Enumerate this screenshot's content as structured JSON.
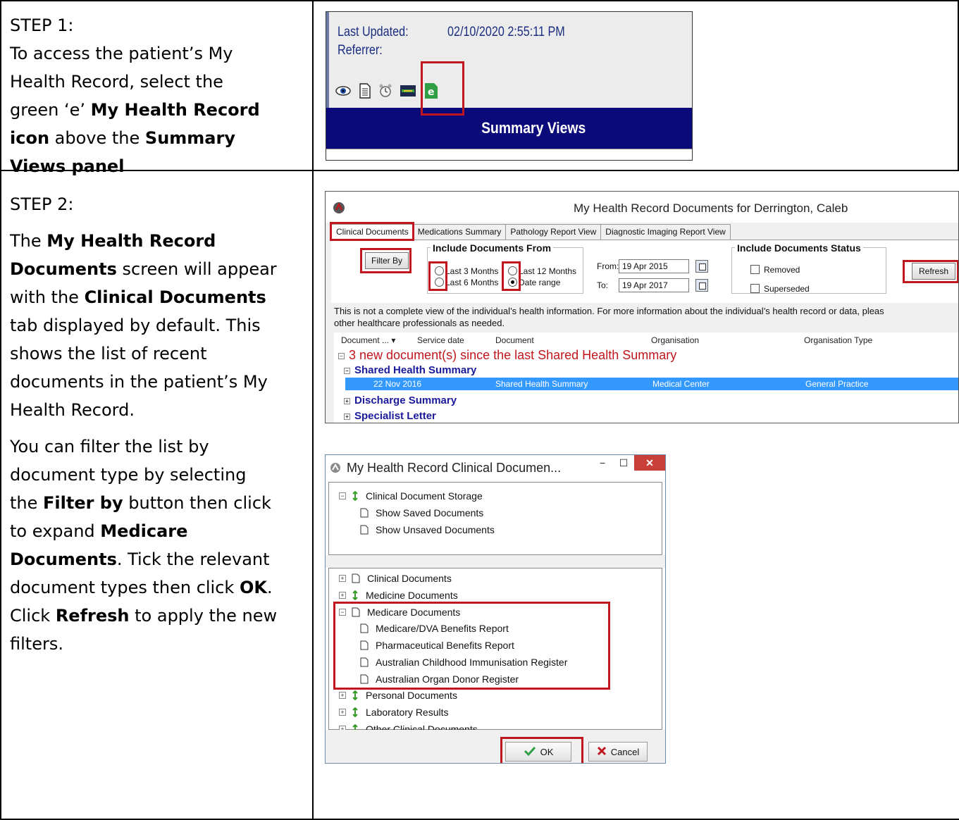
{
  "step1": {
    "heading": "STEP 1:",
    "line1": "To access the patient’s My",
    "line2": "Health Record, select the",
    "line3_a": "green ‘e’ ",
    "line3_b": "My Health Record",
    "line4_a": "icon",
    "line4_b": " above the ",
    "line4_c": "Summary",
    "line5": "Views panel",
    "screenshot": {
      "last_updated_label": "Last Updated:",
      "last_updated_value": "02/10/2020 2:55:11 PM",
      "referrer_label": "Referrer:",
      "summary_views": "Summary Views",
      "icons": [
        "eye-icon",
        "document-icon",
        "alarm-clock-icon",
        "image-icon",
        "my-health-record-e-icon"
      ],
      "e_icon_color": "#2f9e44"
    }
  },
  "step2": {
    "heading": "STEP 2:",
    "p1_1a": "The ",
    "p1_1b": "My Health Record",
    "p1_2a": "Documents",
    "p1_2b": " screen will appear",
    "p1_3a": "with the ",
    "p1_3b": "Clinical Documents",
    "p1_4": "tab displayed by default. This",
    "p1_5": "shows the list of recent",
    "p1_6": "documents in the patient’s My",
    "p1_7": "Health Record.",
    "p2_1": "You can filter the list by",
    "p2_2": "document type by selecting",
    "p2_3a": "the ",
    "p2_3b": "Filter by",
    "p2_3c": " button then click",
    "p2_4a": "to expand ",
    "p2_4b": "Medicare",
    "p2_5a": "Documents",
    "p2_5b": ". Tick the relevant",
    "p2_6a": "document types then click ",
    "p2_6b": "OK",
    "p2_6c": ".",
    "p2_7a": "Click ",
    "p2_7b": "Refresh",
    "p2_7c": " to apply the new",
    "p2_8": "filters."
  },
  "documents_window": {
    "title": "My Health Record Documents for Derrington, Caleb",
    "tabs": [
      "Clinical Documents",
      "Medications Summary",
      "Pathology Report View",
      "Diagnostic Imaging Report View"
    ],
    "filter_by": "Filter By",
    "include_from": "Include Documents From",
    "last3": "Last 3 Months",
    "last6": "Last 6 Months",
    "last12": "Last 12 Months",
    "date_range": "Date range",
    "from_label": "From:",
    "from_value": "19 Apr 2015",
    "to_label": "To:",
    "to_value": "19 Apr 2017",
    "include_status": "Include Documents Status",
    "removed": "Removed",
    "superseded": "Superseded",
    "refresh": "Refresh",
    "notice1": "This is not a complete view of the individual’s health information. For more information about the individual’s health record or data, pleas",
    "notice2": "other healthcare professionals as needed.",
    "columns": [
      "Document ...",
      "Service date",
      "Document",
      "Organisation",
      "Organisation Type"
    ],
    "new_docs": "3 new document(s) since the last Shared Health Summary",
    "group_shs": "Shared Health Summary",
    "row": {
      "date": "22 Nov 2016",
      "document": "Shared Health Summary",
      "organisation": "Medical Center",
      "org_type": "General Practice"
    },
    "group_discharge": "Discharge Summary",
    "group_specialist": "Specialist Letter"
  },
  "filter_window": {
    "title": "My Health Record Clinical Documen...",
    "storage": "Clinical Document Storage",
    "show_saved": "Show Saved Documents",
    "show_unsaved": "Show Unsaved Documents",
    "clinical_docs": "Clinical Documents",
    "medicine_docs": "Medicine Documents",
    "medicare_docs": "Medicare Documents",
    "medicare_items": [
      "Medicare/DVA Benefits Report",
      "Pharmaceutical Benefits Report",
      "Australian Childhood Immunisation Register",
      "Australian Organ Donor Register"
    ],
    "personal_docs": "Personal Documents",
    "lab_results": "Laboratory Results",
    "other_clinical": "Other Clinical Documents",
    "ok": "OK",
    "cancel": "Cancel"
  },
  "colors": {
    "highlight": "#c0161d",
    "summary_bar": "#0b0a7a",
    "selection": "#3399ff",
    "new_docs_red": "#c0161d",
    "group_blue": "#1a1a9c"
  }
}
